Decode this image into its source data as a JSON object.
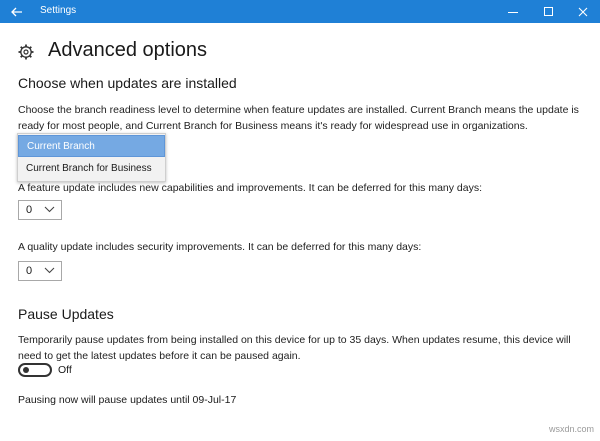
{
  "window": {
    "title": "Settings"
  },
  "page": {
    "title": "Advanced options"
  },
  "updates": {
    "heading": "Choose when updates are installed",
    "branch_description": "Choose the branch readiness level to determine when feature updates are installed. Current Branch means the update is ready for most people, and Current Branch for Business means it's ready for widespread use in organizations.",
    "branch_options": [
      "Current Branch",
      "Current Branch for Business"
    ],
    "branch_selected": "Current Branch",
    "feature_text": "A feature update includes new capabilities and improvements. It can be deferred for this many days:",
    "feature_days": "0",
    "quality_text": "A quality update includes security improvements. It can be deferred for this many days:",
    "quality_days": "0"
  },
  "pause": {
    "heading": "Pause Updates",
    "description": "Temporarily pause updates from being installed on this device for up to 35 days. When updates resume, this device will need to get the latest updates before it can be paused again.",
    "toggle_state": "Off",
    "note": "Pausing now will pause updates until 09-Jul-17"
  },
  "watermark": "wsxdn.com",
  "icons": [
    "back-arrow-icon",
    "minimize-icon",
    "maximize-icon",
    "close-icon",
    "gear-icon",
    "chevron-down-icon"
  ],
  "colors": {
    "titlebar": "#1f80d6",
    "selected_option": "#75a9e3"
  }
}
